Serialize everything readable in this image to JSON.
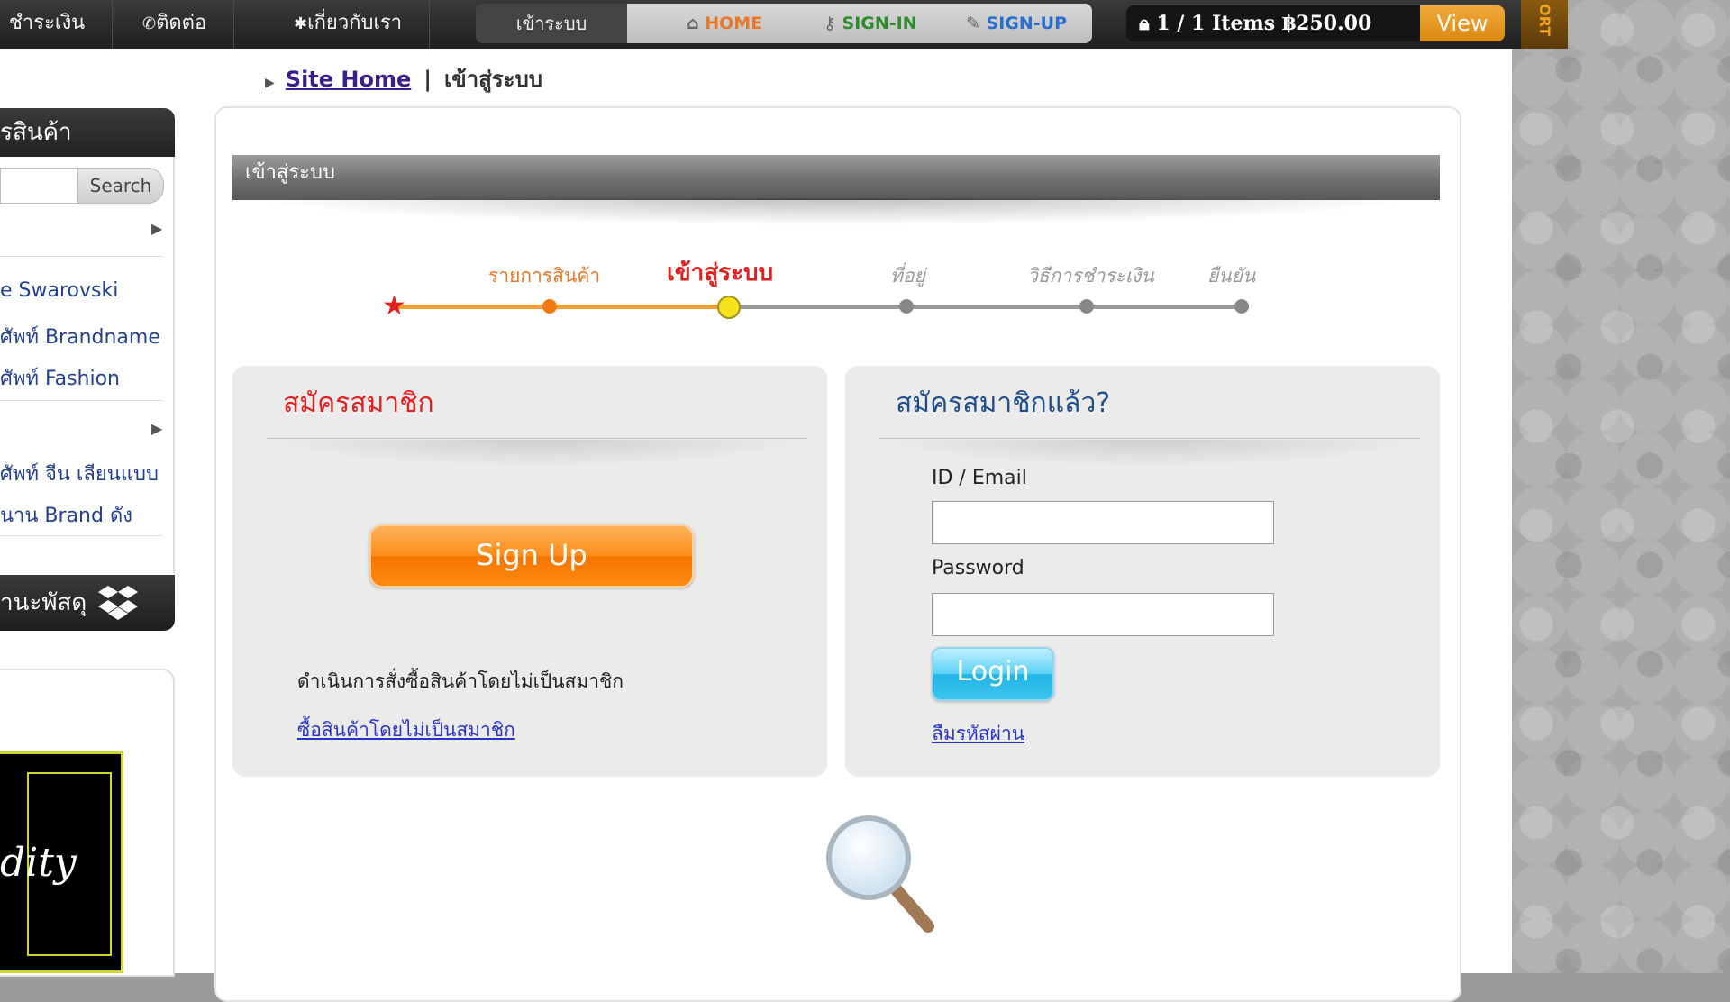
{
  "topnav": {
    "items": [
      "ชำระเงิน",
      "ติดต่อ",
      "เกี่ยวกับเรา"
    ],
    "login_tab": "เข้าระบบ",
    "links": [
      {
        "label": "HOME",
        "color": "#e8782a"
      },
      {
        "label": "SIGN-IN",
        "color": "#2e8b2e"
      },
      {
        "label": "SIGN-UP",
        "color": "#2a6fd0"
      }
    ],
    "cart_text": "1 / 1 Items ฿250.00",
    "view_label": "View",
    "support_label": "ORT"
  },
  "breadcrumb": {
    "home": "Site Home",
    "sep": "|",
    "current": "เข้าสู่ระบบ"
  },
  "sidebar": {
    "head": "รสินค้า",
    "search_label": "Search",
    "links": [
      "e Swarovski",
      "ศัพท์ Brandname",
      "ศัพท์ Fashion",
      "ศัพท์ จีน เลียนแบบ",
      "นาน Brand ดัง"
    ],
    "track_head": "านะพัสดุ"
  },
  "main": {
    "section_title": "เข้าสู่ระบบ",
    "steps": [
      {
        "label": "รายการสินค้า",
        "state": "done"
      },
      {
        "label": "เข้าสู่ระบบ",
        "state": "current"
      },
      {
        "label": "ที่อยู่",
        "state": "todo"
      },
      {
        "label": "วิธีการชำระเงิน",
        "state": "todo"
      },
      {
        "label": "ยืนยัน",
        "state": "todo"
      }
    ],
    "signup_card": {
      "title": "สมัครสมาชิก",
      "button": "Sign Up",
      "guest_text": "ดำเนินการสั่งซื้อสินค้าโดยไม่เป็นสมาชิก",
      "guest_link": "ซื้อสินค้าโดยไม่เป็นสมาชิก"
    },
    "login_card": {
      "title": "สมัครสมาชิกแล้ว?",
      "id_label": "ID / Email",
      "id_value": "",
      "password_label": "Password",
      "password_value": "",
      "button": "Login",
      "forgot": "ลืมรหัสผ่าน"
    }
  },
  "colors": {
    "accent_orange": "#f57e10",
    "accent_red": "#e02020",
    "title_blue": "#1f4e8c",
    "link_blue": "#2a33c8"
  }
}
